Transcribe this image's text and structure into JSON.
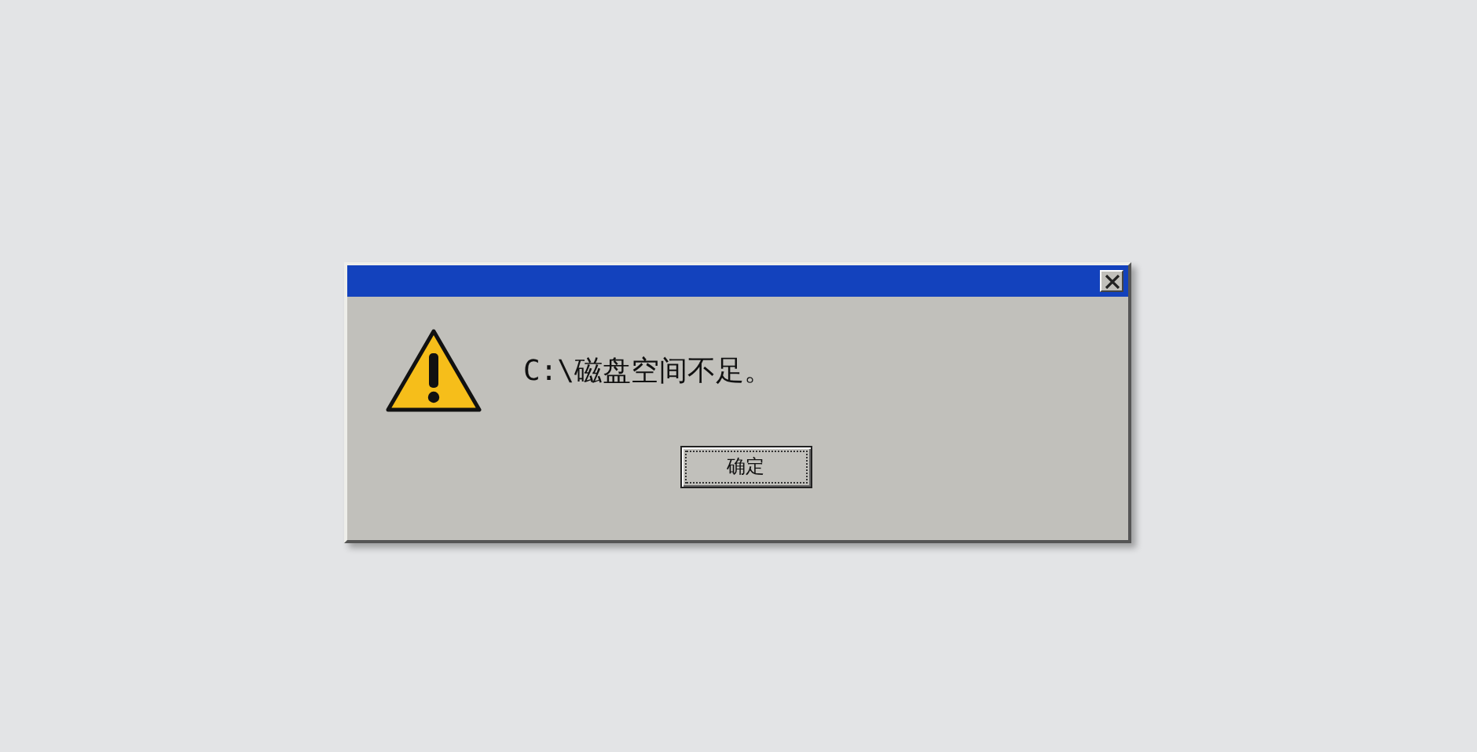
{
  "dialog": {
    "message": "C:\\磁盘空间不足。",
    "buttons": [
      {
        "label": "确定",
        "focused": true
      }
    ]
  }
}
